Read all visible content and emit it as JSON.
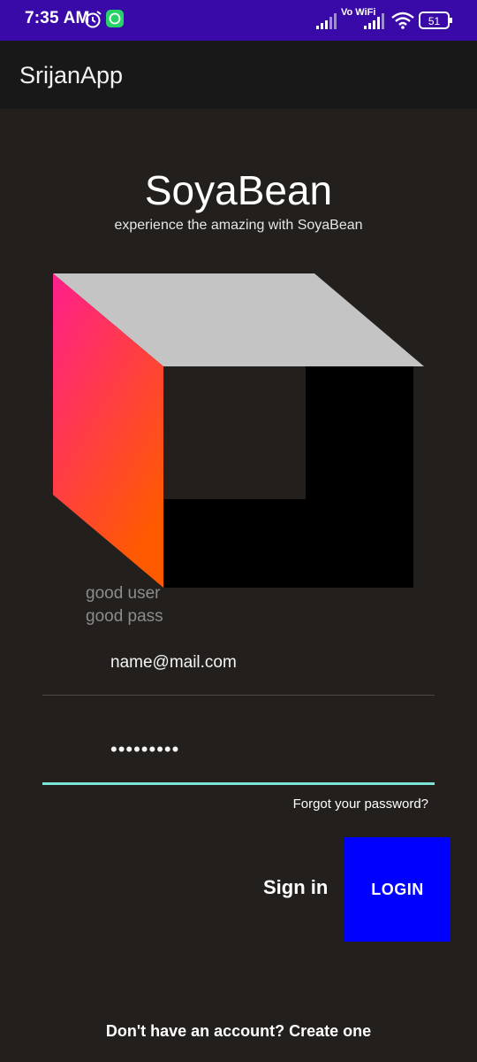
{
  "status_bar": {
    "time": "7:35 AM",
    "network": "Vo WiFi",
    "battery": "51"
  },
  "app_bar": {
    "title": "SrijanApp"
  },
  "brand": {
    "name": "SoyaBean",
    "tagline": "experience the amazing with SoyaBean"
  },
  "colors": {
    "status_bar": "#3a0aa8",
    "background": "#231f1c",
    "app_bar": "#181818",
    "accent_underline": "#7de3d6",
    "login_button": "#0000ff",
    "cube_top": "#c4c4c4",
    "cube_left_gradient": [
      "#ff1f8c",
      "#ff5a00"
    ]
  },
  "hints": {
    "user": "good user",
    "pass": "good pass"
  },
  "form": {
    "email_value": "name@mail.com",
    "password_value": "•••••••••",
    "forgot_password": "Forgot your password?",
    "sign_in_label": "Sign in",
    "login_button": "LOGIN",
    "create_account": "Don't have an account? Create one"
  },
  "icons": [
    "alarm-icon",
    "whatsapp-icon",
    "signal-icon",
    "wifi-icon",
    "battery-icon"
  ]
}
